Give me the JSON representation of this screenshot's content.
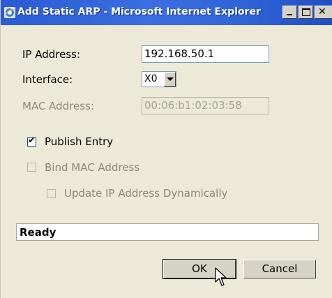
{
  "window": {
    "title": "Add Static ARP - Microsoft Internet Explorer"
  },
  "form": {
    "ip_address": {
      "label": "IP Address:",
      "value": "192.168.50.1"
    },
    "interface": {
      "label": "Interface:",
      "value": "X0"
    },
    "mac_address": {
      "label": "MAC Address:",
      "value": "00:06:b1:02:03:58",
      "disabled": true
    },
    "publish_entry": {
      "label": "Publish Entry",
      "checked": true
    },
    "bind_mac": {
      "label": "Bind MAC Address",
      "checked": false,
      "disabled": true
    },
    "update_ip": {
      "label": "Update IP Address Dynamically",
      "checked": false,
      "disabled": true
    }
  },
  "status": {
    "text": "Ready"
  },
  "buttons": {
    "ok": "OK",
    "cancel": "Cancel"
  },
  "icons": {
    "app": "ie-icon",
    "minimize": "minimize-icon",
    "maximize": "maximize-icon",
    "close": "close-icon",
    "cursor": "mouse-pointer-icon"
  },
  "colors": {
    "titlebar": "#2a5bd4",
    "window_bg": "#ece9d8"
  }
}
